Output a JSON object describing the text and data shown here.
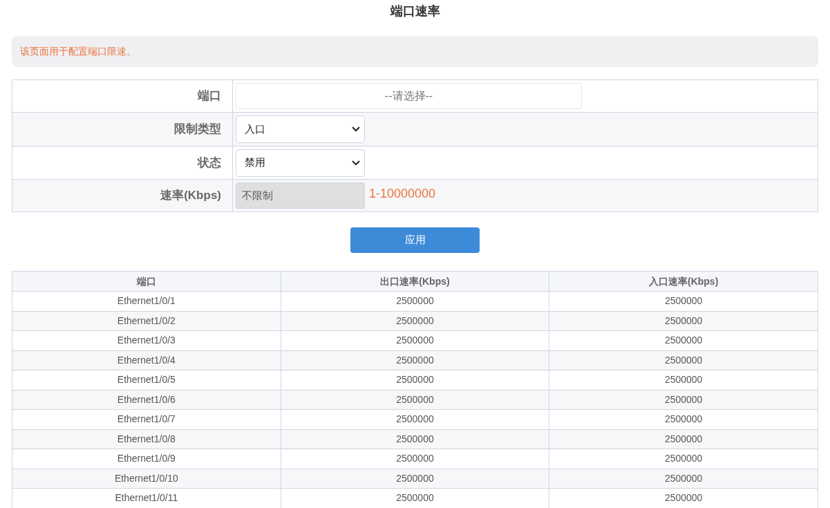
{
  "title": "端口速率",
  "notice": "该页面用于配置端口限速。",
  "form": [
    {
      "kind": "picker",
      "label": "端口",
      "placeholder": "--请选择--"
    },
    {
      "kind": "select",
      "label": "限制类型",
      "value": "入口"
    },
    {
      "kind": "select",
      "label": "状态",
      "value": "禁用"
    },
    {
      "kind": "input",
      "label": "速率(Kbps)",
      "value": "不限制",
      "disabled": true,
      "hint": "1-10000000"
    }
  ],
  "apply_button": "应用",
  "table": {
    "columns": [
      "端口",
      "出口速率(Kbps)",
      "入口速率(Kbps)"
    ],
    "rows": [
      [
        "Ethernet1/0/1",
        "2500000",
        "2500000"
      ],
      [
        "Ethernet1/0/2",
        "2500000",
        "2500000"
      ],
      [
        "Ethernet1/0/3",
        "2500000",
        "2500000"
      ],
      [
        "Ethernet1/0/4",
        "2500000",
        "2500000"
      ],
      [
        "Ethernet1/0/5",
        "2500000",
        "2500000"
      ],
      [
        "Ethernet1/0/6",
        "2500000",
        "2500000"
      ],
      [
        "Ethernet1/0/7",
        "2500000",
        "2500000"
      ],
      [
        "Ethernet1/0/8",
        "2500000",
        "2500000"
      ],
      [
        "Ethernet1/0/9",
        "2500000",
        "2500000"
      ],
      [
        "Ethernet1/0/10",
        "2500000",
        "2500000"
      ],
      [
        "Ethernet1/0/11",
        "2500000",
        "2500000"
      ]
    ]
  }
}
